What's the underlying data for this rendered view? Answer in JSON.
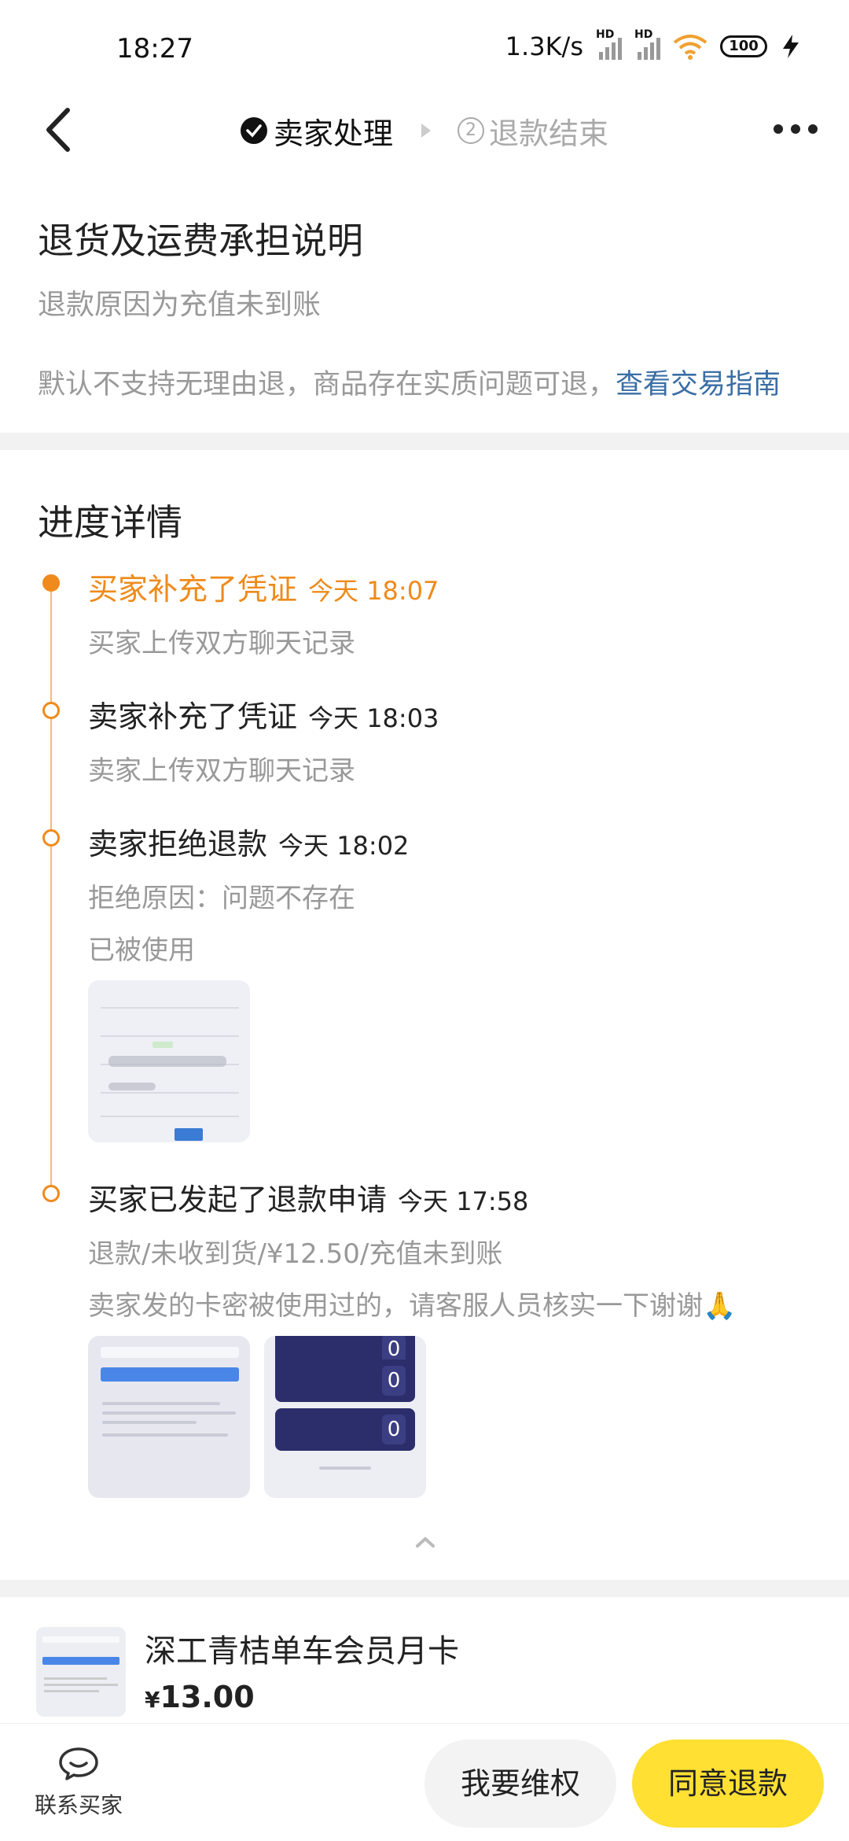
{
  "status_bar": {
    "time": "18:27",
    "speed": "1.3K/s",
    "hd_label": "HD",
    "battery": "100"
  },
  "header": {
    "step1_label": "卖家处理",
    "step2_number": "2",
    "step2_label": "退款结束"
  },
  "policy": {
    "title": "退货及运费承担说明",
    "reason": "退款原因为充值未到账",
    "note": "默认不支持无理由退，商品存在实质问题可退，",
    "link": "查看交易指南"
  },
  "progress": {
    "title": "进度详情",
    "events": [
      {
        "title": "买家补充了凭证",
        "time": "今天 18:07",
        "lines": [
          "买家上传双方聊天记录"
        ]
      },
      {
        "title": "卖家补充了凭证",
        "time": "今天 18:03",
        "lines": [
          "卖家上传双方聊天记录"
        ]
      },
      {
        "title": "卖家拒绝退款",
        "time": "今天 18:02",
        "lines": [
          "拒绝原因：问题不存在",
          "已被使用"
        ]
      },
      {
        "title": "买家已发起了退款申请",
        "time": "今天 17:58",
        "lines": [
          "退款/未收到货/¥12.50/充值未到账",
          "卖家发的卡密被使用过的，请客服人员核实一下谢谢🙏"
        ]
      }
    ]
  },
  "product": {
    "name": "深工青桔单车会员月卡",
    "currency": "¥",
    "price": "13.00"
  },
  "bottom": {
    "contact_label": "联系买家",
    "rights_label": "我要维权",
    "agree_label": "同意退款"
  },
  "colors": {
    "accent_orange": "#ef8a1a",
    "link_blue": "#3a6ea5",
    "agree_yellow": "#ffe033"
  }
}
